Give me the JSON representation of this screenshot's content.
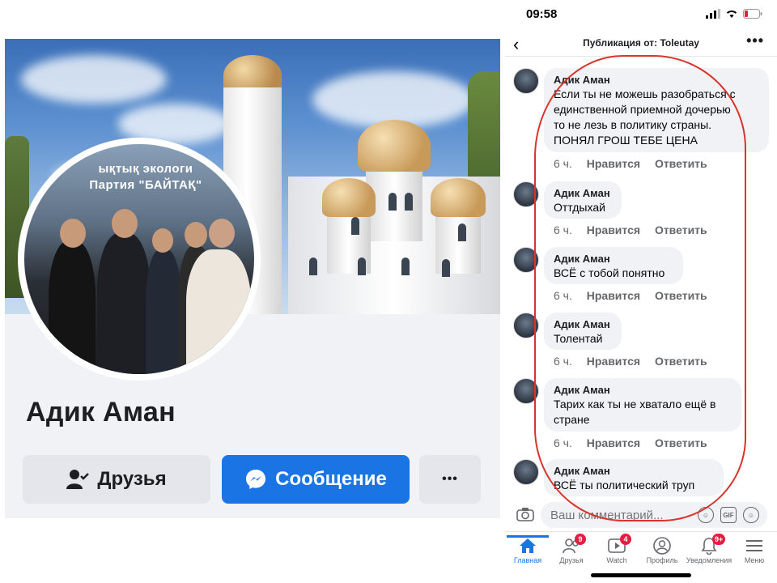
{
  "profile": {
    "name": "Адик Аман",
    "avatar_caption_line1": "ықтық экологи",
    "avatar_caption_line2": "Партия \"БАЙТАҚ\"",
    "buttons": {
      "friends": "Друзья",
      "message": "Сообщение",
      "more": "•••"
    }
  },
  "phone": {
    "status": {
      "time": "09:58"
    },
    "header": {
      "title": "Публикация от: Toleutay",
      "back": "‹",
      "more": "•••"
    },
    "comments": [
      {
        "author": "Адик Аман",
        "text": "Если ты не можешь разобраться с\nединственной  приемной дочерью\nто не лезь в политику страны.\nПОНЯЛ ГРОШ ТЕБЕ ЦЕНА",
        "time": "6 ч.",
        "like": "Нравится",
        "reply": "Ответить"
      },
      {
        "author": "Адик Аман",
        "text": "Оттдыхай",
        "time": "6 ч.",
        "like": "Нравится",
        "reply": "Ответить"
      },
      {
        "author": "Адик Аман",
        "text": "ВСЁ с тобой понятно",
        "time": "6 ч.",
        "like": "Нравится",
        "reply": "Ответить"
      },
      {
        "author": "Адик Аман",
        "text": "Толентай",
        "time": "6 ч.",
        "like": "Нравится",
        "reply": "Ответить"
      },
      {
        "author": "Адик Аман",
        "text": "Тарих как ты не хватало ещё в\nстране",
        "time": "6 ч.",
        "like": "Нравится",
        "reply": "Ответить"
      },
      {
        "author": "Адик Аман",
        "text": "ВСЁ ты политический труп"
      }
    ],
    "composer": {
      "placeholder": "Ваш комментарий..."
    },
    "nav": [
      {
        "label": "Главная",
        "icon": "home-icon",
        "active": true
      },
      {
        "label": "Друзья",
        "icon": "friends-icon",
        "badge": "9"
      },
      {
        "label": "Watch",
        "icon": "watch-icon",
        "badge": "4"
      },
      {
        "label": "Профиль",
        "icon": "profile-icon"
      },
      {
        "label": "Уведомления",
        "icon": "bell-icon",
        "badge": "9+"
      },
      {
        "label": "Меню",
        "icon": "menu-icon"
      }
    ],
    "colors": {
      "accent": "#1b74e4",
      "badge": "#e41e3f",
      "annotation": "#d9342b"
    }
  }
}
